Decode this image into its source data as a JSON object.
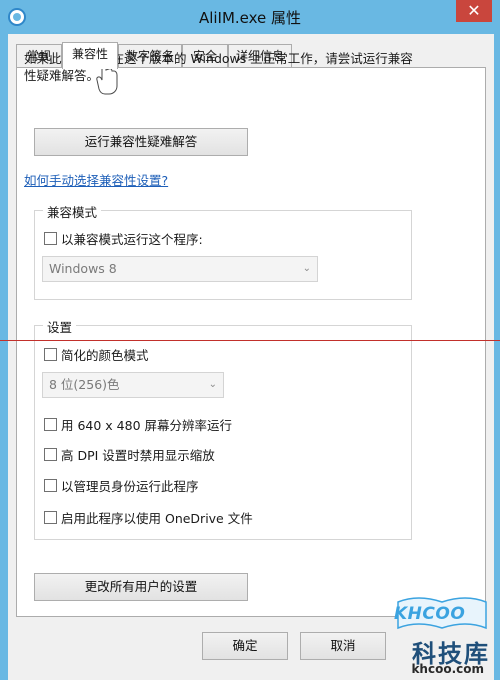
{
  "window": {
    "title": "AliIM.exe 属性",
    "close_glyph": "✕"
  },
  "tabs": [
    {
      "label": "常规",
      "active": false
    },
    {
      "label": "兼容性",
      "active": true
    },
    {
      "label": "数字签名",
      "active": false
    },
    {
      "label": "安全",
      "active": false
    },
    {
      "label": "详细信息",
      "active": false
    }
  ],
  "compat": {
    "description": "如果此程序不能在这个版本的 Windows 上正常工作，请尝试运行兼容性疑难解答。",
    "troubleshoot_button": "运行兼容性疑难解答",
    "manual_link": "如何手动选择兼容性设置?",
    "mode_group": {
      "title": "兼容模式",
      "checkbox_label": "以兼容模式运行这个程序:",
      "checked": false,
      "os_select_value": "Windows 8"
    },
    "settings_group": {
      "title": "设置",
      "reduced_color": {
        "label": "简化的颜色模式",
        "checked": false
      },
      "color_select_value": "8 位(256)色",
      "options": [
        {
          "label": "用 640 x 480 屏幕分辨率运行",
          "checked": false
        },
        {
          "label": "高 DPI 设置时禁用显示缩放",
          "checked": false
        },
        {
          "label": "以管理员身份运行此程序",
          "checked": false
        },
        {
          "label": "启用此程序以使用 OneDrive 文件",
          "checked": false
        }
      ]
    },
    "all_users_button": "更改所有用户的设置"
  },
  "footer": {
    "ok": "确定",
    "cancel": "取消"
  },
  "watermark": {
    "logo": "KHCOO",
    "name": "科技库",
    "url": "khcoo.com"
  },
  "colors": {
    "frame": "#69b8e3",
    "link": "#1e5fb8",
    "close": "#c9463d",
    "annotation_line": "#c2302b"
  },
  "icons": {
    "select_arrow": "⌄",
    "app": "app-icon"
  }
}
